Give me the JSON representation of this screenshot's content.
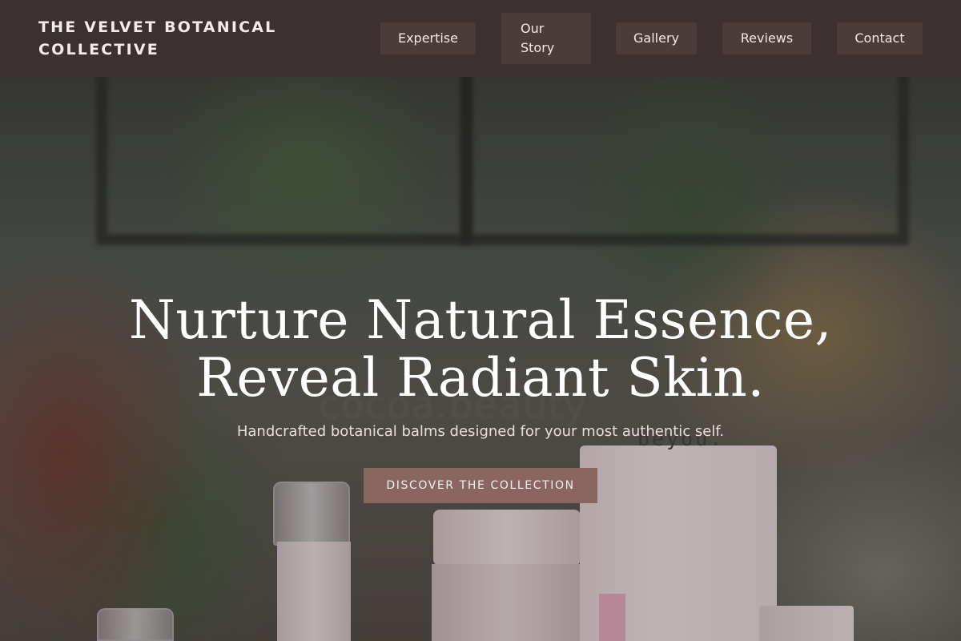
{
  "header": {
    "brand": "THE VELVET BOTANICAL COLLECTIVE",
    "nav": [
      {
        "label": "Expertise"
      },
      {
        "label": "Our Story"
      },
      {
        "label": "Gallery"
      },
      {
        "label": "Reviews"
      },
      {
        "label": "Contact"
      }
    ]
  },
  "hero": {
    "headline": "Nurture Natural Essence, Reveal Radiant Skin.",
    "subheadline": "Handcrafted botanical balms designed for your most authentic self.",
    "cta_label": "DISCOVER THE COLLECTION",
    "photo_text": {
      "tube_brand": "beyou.",
      "background_logo": "cocoa.beauty"
    }
  },
  "colors": {
    "header_bg": "#3c3130",
    "nav_button_bg": "#4b3c3a",
    "cta_bg": "#8a6660",
    "text_light": "#ffffff"
  }
}
